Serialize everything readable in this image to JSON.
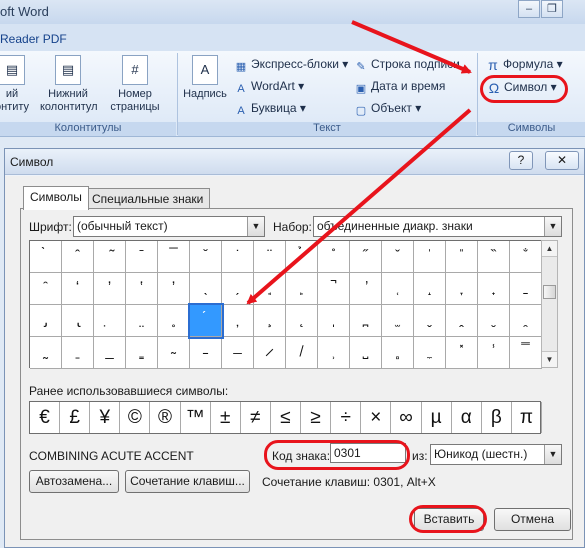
{
  "word": {
    "title": "oft Word",
    "tab_label": "Reader PDF",
    "groups": {
      "header_footer": "Колонтитулы",
      "text": "Текст",
      "symbols": "Символы"
    },
    "buttons": {
      "header_partial": "ий\nонтиту",
      "footer": "Нижний\nколонтитул",
      "page_number": "Номер\nстраницы",
      "textbox": "Надпись",
      "quick_parts": "Экспресс-блоки",
      "wordart": "WordArt",
      "dropcap": "Буквица",
      "signature_line": "Строка подписи",
      "date_time": "Дата и время",
      "object": "Объект",
      "equation": "Формула",
      "symbol": "Символ"
    }
  },
  "dialog": {
    "title": "Символ",
    "help_glyph": "?",
    "close_glyph": "✕",
    "tabs": [
      "Символы",
      "Специальные знаки"
    ],
    "font_label": "Шрифт:",
    "font_value": "(обычный текст)",
    "subset_label": "Набор:",
    "subset_value": "объединенные диакр. знаки",
    "grid": [
      [
        "̀",
        "̂",
        "̃",
        "̄",
        "̅",
        "̆",
        "̇",
        "̈",
        "̉",
        "̊",
        "̋",
        "̌",
        "̍",
        "̎",
        "̏",
        "̐"
      ],
      [
        "̑",
        "̒",
        "̓",
        "̔",
        "̕",
        "̖",
        "̗",
        "̘",
        "̙",
        "̚",
        "̛",
        "̜",
        "̝",
        "̞",
        "̟",
        "̠"
      ],
      [
        "̡",
        "̢",
        "̣",
        "̤",
        "̥",
        "́",
        "̦",
        "̧",
        "̨",
        "̩",
        "̪",
        "̫",
        "̬",
        "̭",
        "̮",
        "̯"
      ],
      [
        "̰",
        "̱",
        "̲",
        "̳",
        "̴",
        "̵",
        "̶",
        "̷",
        "̸",
        "̹",
        "̺",
        "̻",
        "̼",
        "̽",
        "̾",
        "̿"
      ]
    ],
    "selected_cell": {
      "row": 2,
      "col": 5
    },
    "recent_label": "Ранее использовавшиеся символы:",
    "recent": [
      "€",
      "£",
      "¥",
      "©",
      "®",
      "™",
      "±",
      "≠",
      "≤",
      "≥",
      "÷",
      "×",
      "∞",
      "µ",
      "α",
      "β",
      "π"
    ],
    "char_name": "COMBINING ACUTE ACCENT",
    "code_label": "Код знака:",
    "code_value": "0301",
    "from_label": "из:",
    "from_value": "Юникод (шестн.)",
    "autocorrect_button": "Автозамена...",
    "shortcut_button": "Сочетание клавиш...",
    "shortcut_text": "Сочетание клавиш: 0301, Alt+X",
    "insert_button": "Вставить",
    "cancel_button": "Отмена"
  },
  "colors": {
    "annotation": "#e8141c",
    "selection": "#3399ff"
  }
}
